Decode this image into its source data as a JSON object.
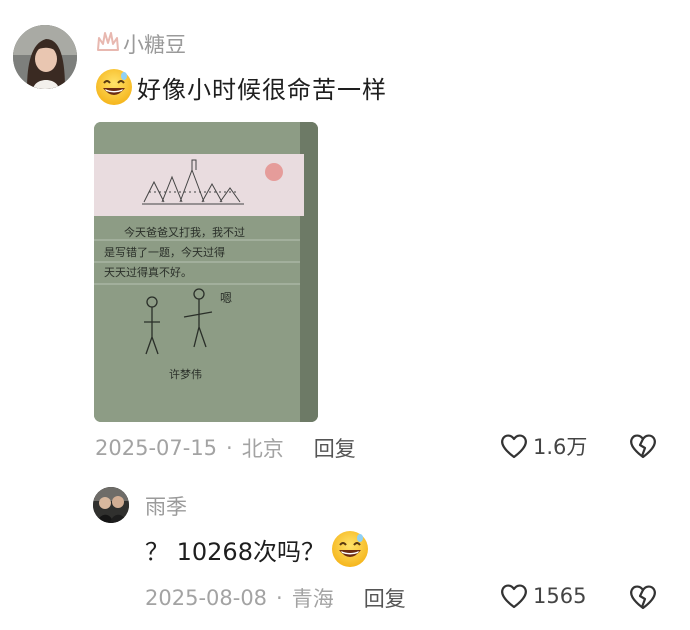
{
  "comment": {
    "username": "小糖豆",
    "text": "好像小时候很命苦一样",
    "date": "2025-07-15",
    "location": "北京",
    "reply_label": "回复",
    "likes": "1.6万",
    "emoji": "grinning-sweat-emoji",
    "photo_text": {
      "line1": "今天爸爸又打我，我不过",
      "line2": "是写错了一题，今天过得",
      "line3": "天天过得真不好。",
      "bubble": "嗯",
      "signature": "许梦伟"
    }
  },
  "reply": {
    "username": "雨季",
    "text": "？ 10268次吗？",
    "date": "2025-08-08",
    "location": "青海",
    "reply_label": "回复",
    "likes": "1565",
    "emoji": "grinning-sweat-emoji"
  },
  "separator": "·",
  "colors": {
    "meta_gray": "#a3a3a3",
    "name_gray": "#9a9a9a",
    "text": "#1e1e1e",
    "paper_green": "#8e9e86"
  }
}
